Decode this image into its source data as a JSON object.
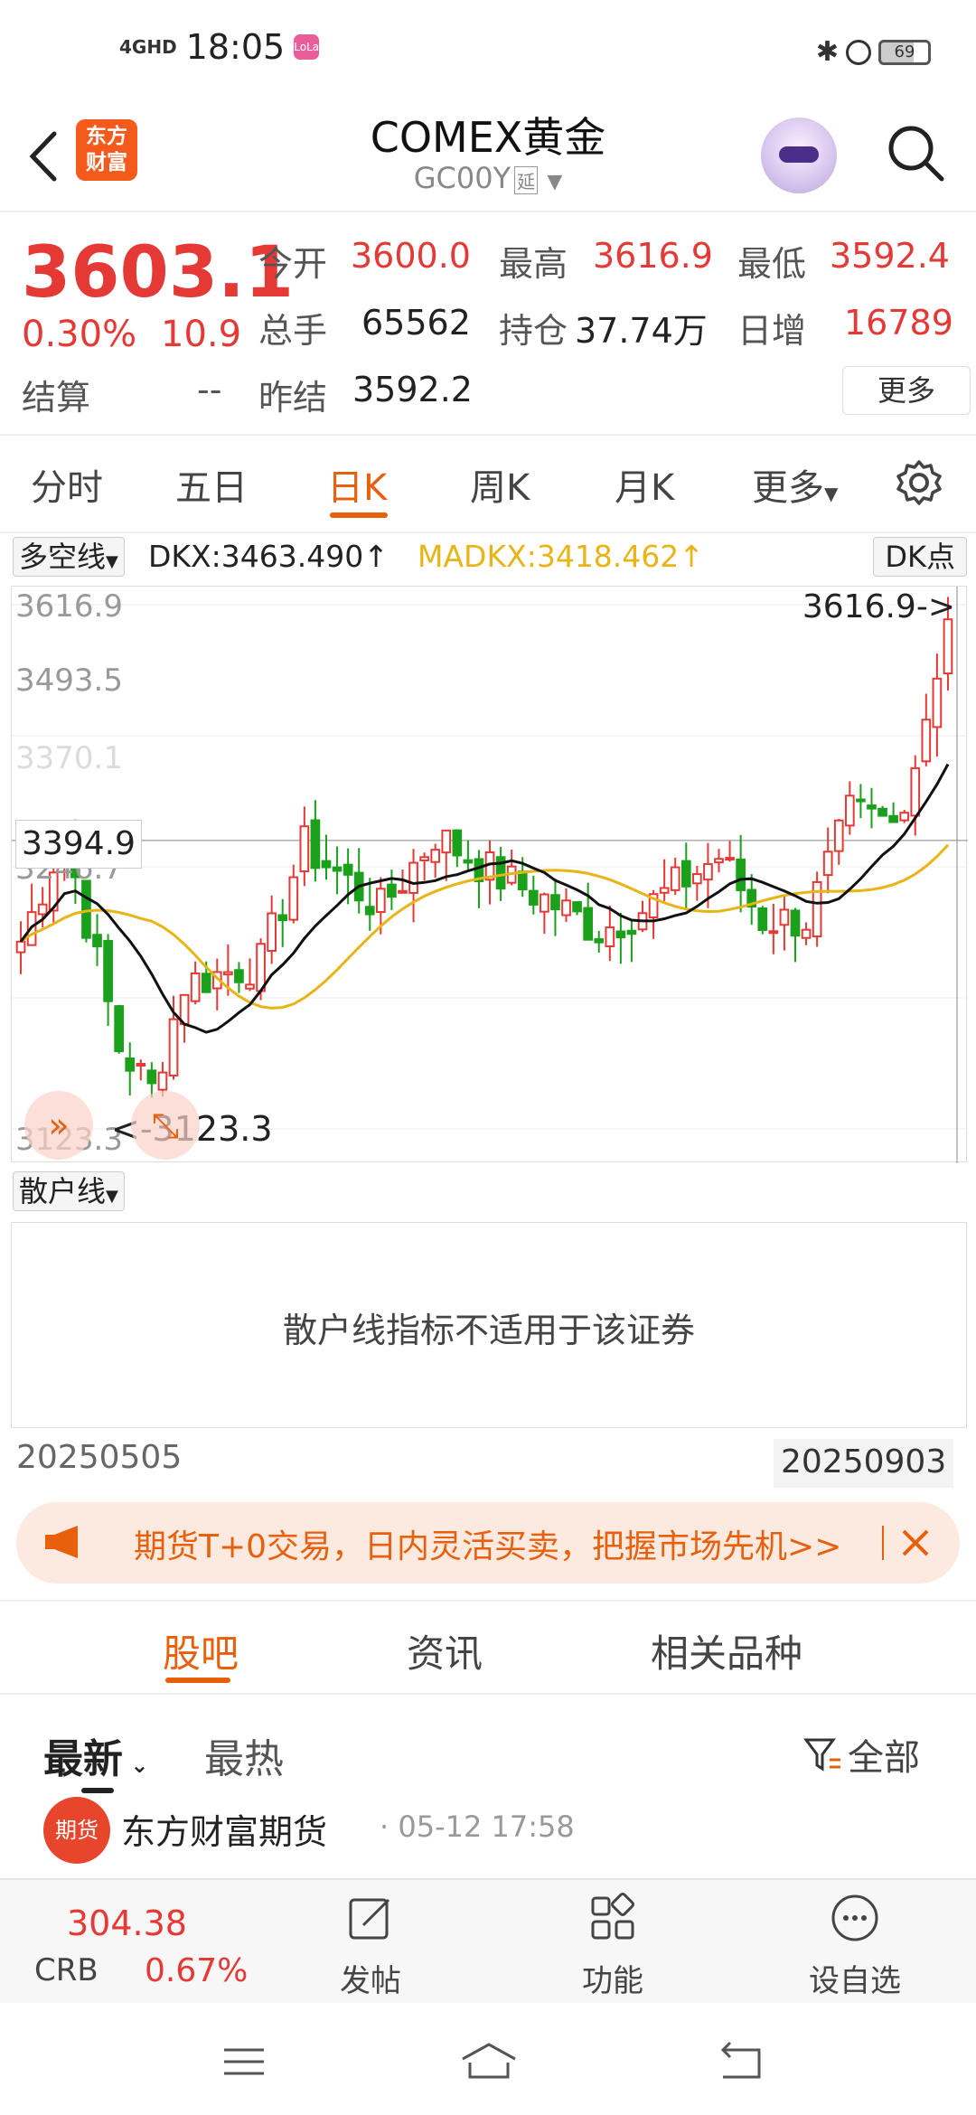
{
  "status_bar": {
    "network": "4GHD",
    "time": "18:05",
    "app_badge": "LoLa",
    "battery": "69"
  },
  "header": {
    "title": "COMEX黄金",
    "code": "GC00Y",
    "delay_tag": "延",
    "logo_line1": "东方",
    "logo_line2": "财富"
  },
  "quote": {
    "price": "3603.1",
    "change_pct": "0.30%",
    "change": "10.9",
    "settle_label": "结算",
    "settle_value": "--",
    "open_label": "今开",
    "open": "3600.0",
    "high_label": "最高",
    "high": "3616.9",
    "low_label": "最低",
    "low": "3592.4",
    "volume_label": "总手",
    "volume": "65562",
    "oi_label": "持仓",
    "oi": "37.74万",
    "daily_inc_label": "日增",
    "daily_inc": "16789",
    "prev_settle_label": "昨结",
    "prev_settle": "3592.2",
    "more_label": "更多"
  },
  "tabs": [
    "分时",
    "五日",
    "日K",
    "周K",
    "月K",
    "更多"
  ],
  "active_tab": "日K",
  "indicator": {
    "selector": "多空线",
    "dkx": "DKX:3463.490↑",
    "madkx": "MADKX:3418.462↑",
    "dk_button": "DK点"
  },
  "chart_labels": {
    "y1": "3616.9",
    "y2": "3493.5",
    "y3": "3370.1",
    "y4": "3246.7",
    "y5": "3123.3",
    "current": "3394.9",
    "high_mark": "3616.9->",
    "low_mark": "<-3123.3"
  },
  "chart_data": {
    "type": "candlestick",
    "ylim": [
      3123.3,
      3616.9
    ],
    "x_start": "20250505",
    "x_end": "20250903",
    "series": [
      {
        "name": "DKX",
        "color": "#111111"
      },
      {
        "name": "MADKX",
        "color": "#e8b416"
      }
    ]
  },
  "retail": {
    "selector": "散户线",
    "message": "散户线指标不适用于该证券"
  },
  "dates": {
    "start": "20250505",
    "end": "20250903"
  },
  "banner": {
    "text": "期货T+0交易，日内灵活买卖，把握市场先机>>"
  },
  "content_tabs": [
    "股吧",
    "资讯",
    "相关品种"
  ],
  "sub_tabs": {
    "latest": "最新",
    "hot": "最热",
    "filter": "全部"
  },
  "post": {
    "avatar": "期货",
    "author": "东方财富期货",
    "time": "· 05-12 17:58"
  },
  "bottom_bar": {
    "crb_value": "304.38",
    "crb_label": "CRB",
    "crb_pct": "0.67%",
    "post_label": "发帖",
    "func_label": "功能",
    "watch_label": "设自选"
  },
  "colors": {
    "up": "#e53935",
    "down": "#1aa01a",
    "accent": "#e8600c",
    "madkx": "#e8b416"
  }
}
